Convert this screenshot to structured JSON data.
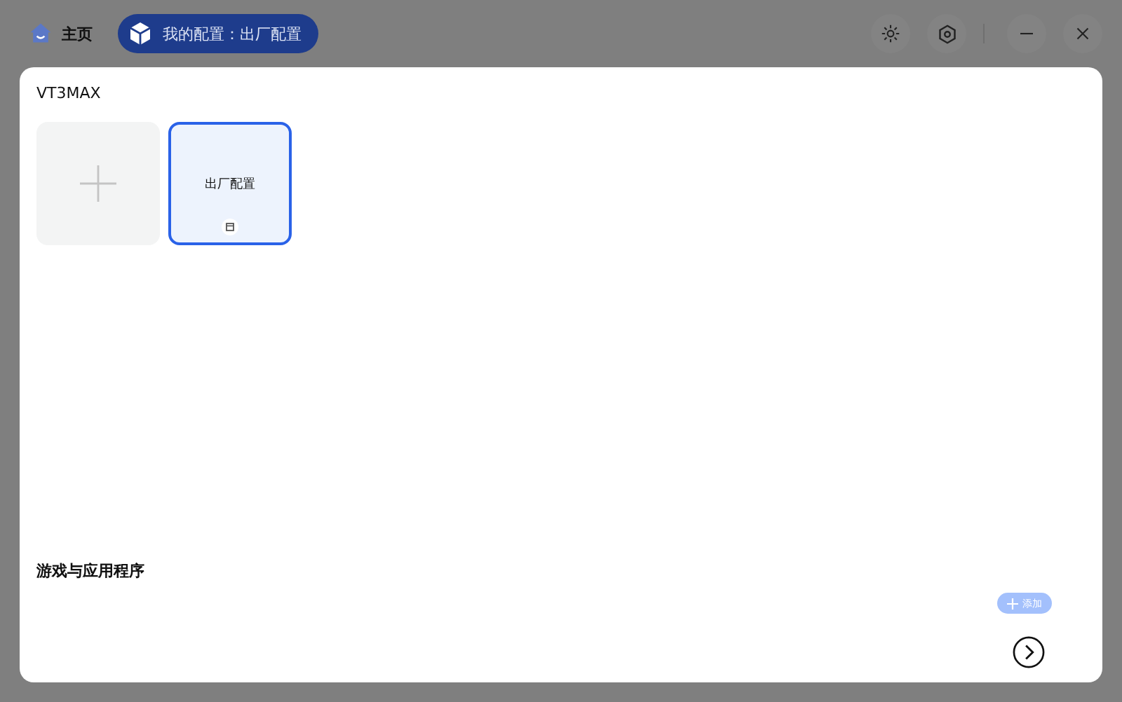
{
  "tabs": [
    {
      "kind": "home",
      "label": "主页",
      "selected": false
    },
    {
      "kind": "profile",
      "label": "我的配置：出厂配置",
      "selected": true
    }
  ],
  "device": {
    "name": "VT3MAX"
  },
  "profiles": [
    {
      "kind": "add",
      "selected": false
    },
    {
      "kind": "profile",
      "label": "出厂配置",
      "selected": true
    }
  ],
  "apps_section": {
    "title": "游戏与应用程序",
    "add_button": {
      "label": "添加",
      "disabled": true
    }
  }
}
